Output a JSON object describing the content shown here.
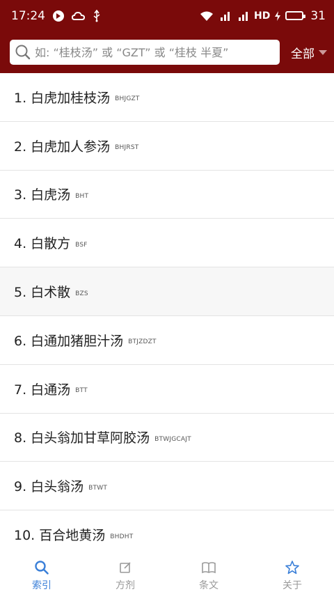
{
  "status": {
    "time": "17:24",
    "network_label": "HD",
    "battery_level": "31",
    "battery_percent": 0.31,
    "icons": [
      "media-icon",
      "cloud-icon",
      "usb-icon",
      "wifi-icon",
      "signal-5g-icon",
      "signal-4g-icon",
      "hd-icon",
      "charging-icon",
      "battery-icon"
    ]
  },
  "search": {
    "placeholder": "如: “桂枝汤” 或 “GZT” 或 “桂枝 半夏”",
    "value": "",
    "filter_label": "全部"
  },
  "list": {
    "items": [
      {
        "title": "1. 白虎加桂枝汤",
        "code": "BHJGZT"
      },
      {
        "title": "2. 白虎加人参汤",
        "code": "BHJRST"
      },
      {
        "title": "3. 白虎汤",
        "code": "BHT"
      },
      {
        "title": "4. 白散方",
        "code": "BSF"
      },
      {
        "title": "5. 白术散",
        "code": "BZS"
      },
      {
        "title": "6. 白通加猪胆汁汤",
        "code": "BTJZDZT"
      },
      {
        "title": "7. 白通汤",
        "code": "BTT"
      },
      {
        "title": "8. 白头翁加甘草阿胶汤",
        "code": "BTWJGCAJT"
      },
      {
        "title": "9. 白头翁汤",
        "code": "BTWT"
      },
      {
        "title": "10. 百合地黄汤",
        "code": "BHDHT"
      }
    ]
  },
  "tabs": [
    {
      "label": "索引",
      "icon": "search-icon",
      "active": true
    },
    {
      "label": "方剂",
      "icon": "edit-icon",
      "active": false
    },
    {
      "label": "条文",
      "icon": "book-icon",
      "active": false
    },
    {
      "label": "关于",
      "icon": "star-icon",
      "active": false
    }
  ],
  "colors": {
    "header": "#7a0a0a",
    "active_tab": "#3a7fd8",
    "inactive_tab": "#999999",
    "battery_fill": "#35c24a"
  }
}
